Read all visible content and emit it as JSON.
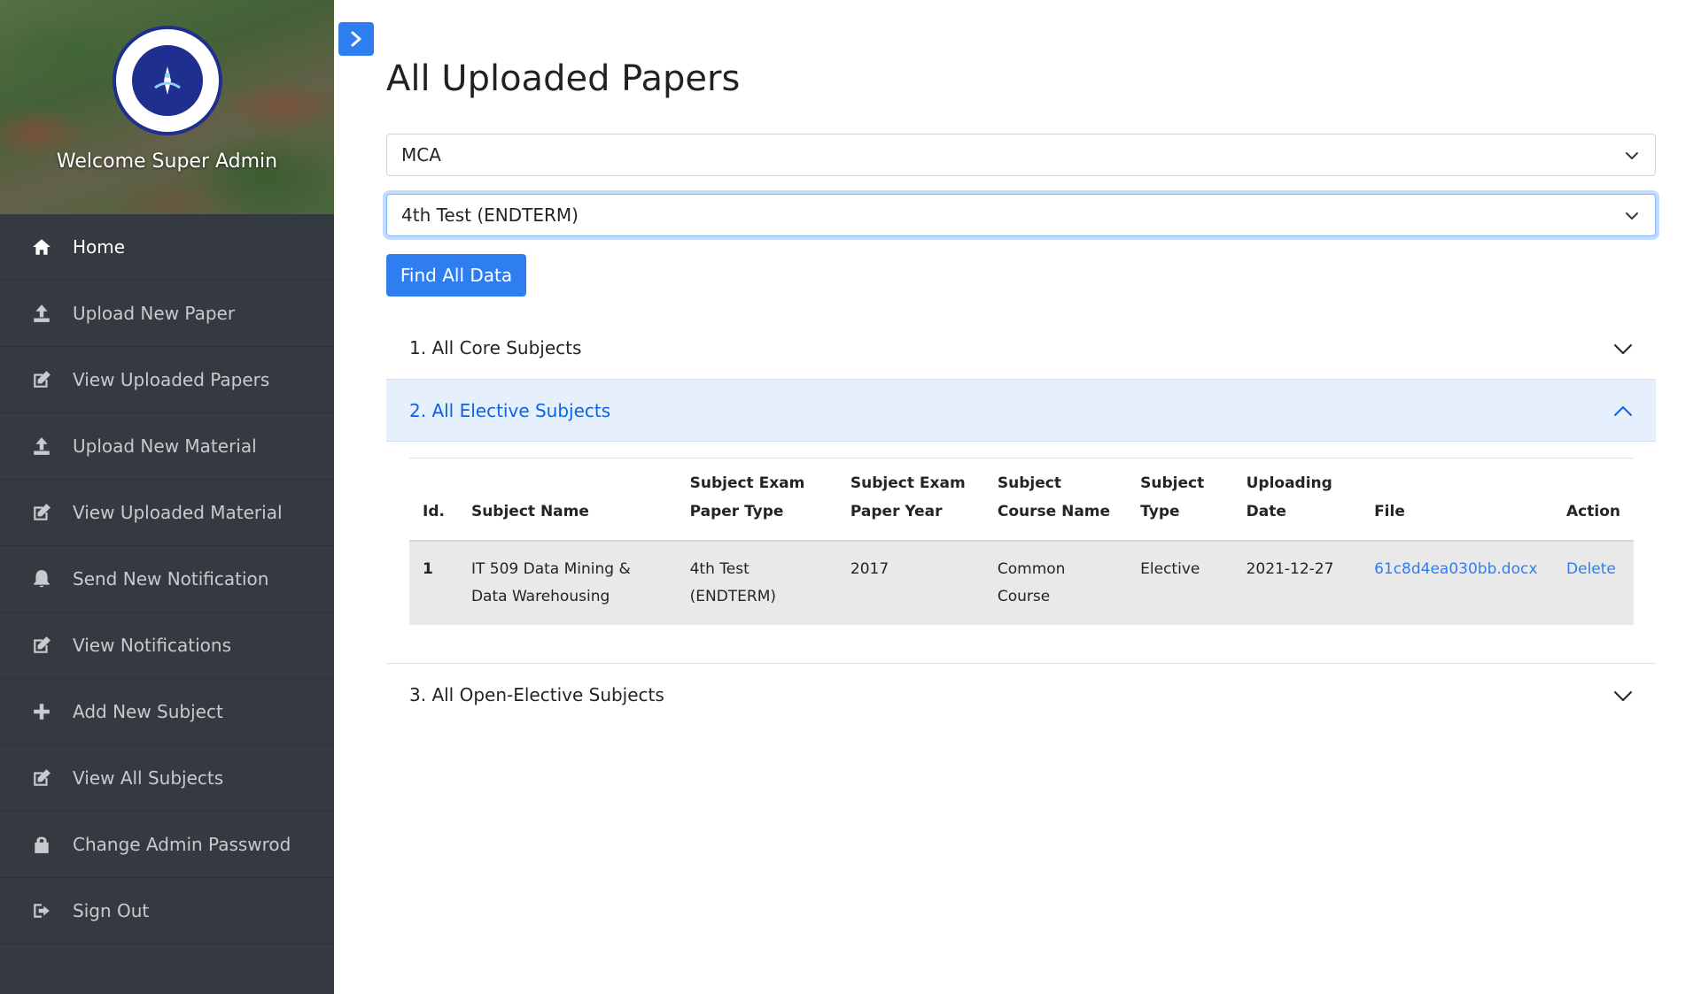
{
  "sidebar": {
    "welcome": "Welcome Super Admin",
    "items": [
      {
        "label": "Home",
        "icon": "home-icon"
      },
      {
        "label": "Upload New Paper",
        "icon": "upload-icon"
      },
      {
        "label": "View Uploaded Papers",
        "icon": "edit-icon"
      },
      {
        "label": "Upload New Material",
        "icon": "upload-icon"
      },
      {
        "label": "View Uploaded Material",
        "icon": "edit-icon"
      },
      {
        "label": "Send New Notification",
        "icon": "bell-icon"
      },
      {
        "label": "View Notifications",
        "icon": "edit-icon"
      },
      {
        "label": "Add New Subject",
        "icon": "plus-icon"
      },
      {
        "label": "View All Subjects",
        "icon": "edit-icon"
      },
      {
        "label": "Change Admin Passwrod",
        "icon": "lock-icon"
      },
      {
        "label": "Sign Out",
        "icon": "sign-out-icon"
      }
    ]
  },
  "main": {
    "title": "All Uploaded Papers",
    "course_select": "MCA",
    "test_select": "4th Test (ENDTERM)",
    "find_button": "Find All Data",
    "accordion": {
      "core": "1. All Core Subjects",
      "elective": "2. All Elective Subjects",
      "open_elective": "3. All Open-Elective Subjects"
    },
    "table": {
      "headers": {
        "id": "Id.",
        "subject_name": "Subject Name",
        "paper_type": "Subject Exam Paper Type",
        "paper_year": "Subject Exam Paper Year",
        "course_name": "Subject Course Name",
        "subject_type": "Subject Type",
        "upload_date": "Uploading Date",
        "file": "File",
        "action": "Action"
      },
      "rows": [
        {
          "id": "1",
          "subject_name": "IT 509 Data Mining & Data Warehousing",
          "paper_type": "4th Test (ENDTERM)",
          "paper_year": "2017",
          "course_name": "Common Course",
          "subject_type": "Elective",
          "upload_date": "2021-12-27",
          "file": "61c8d4ea030bb.docx",
          "action": "Delete"
        }
      ]
    }
  },
  "colors": {
    "sidebar_bg": "#343a40",
    "primary": "#2f7ef0",
    "accordion_open_bg": "#e6f0fd",
    "accordion_open_text": "#0c63e4"
  }
}
